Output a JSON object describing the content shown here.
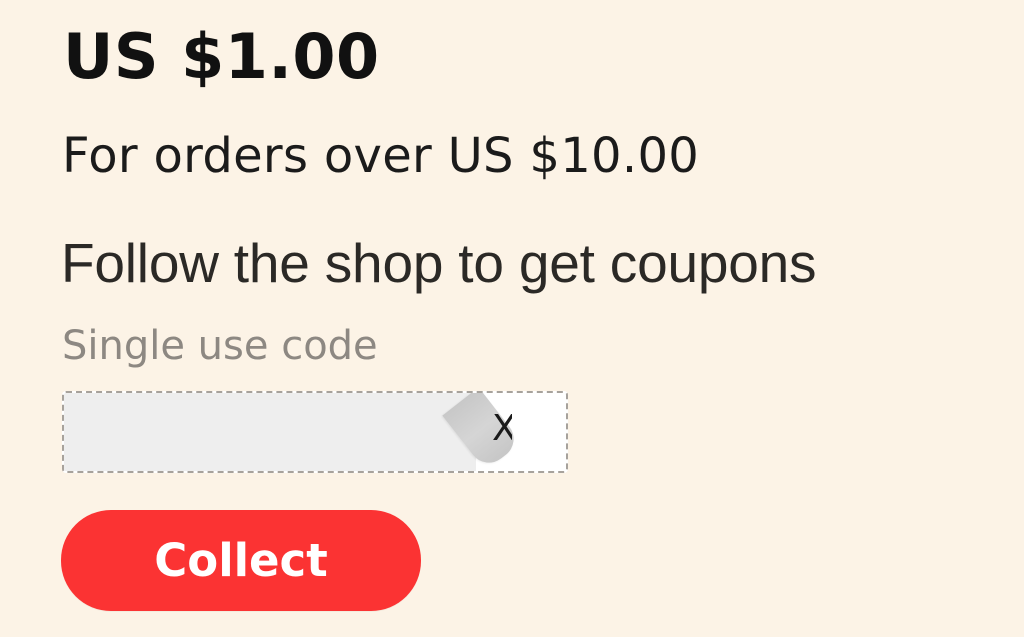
{
  "coupon": {
    "amount": "US $1.00",
    "condition": "For orders over US $10.00",
    "follow_note": "Follow the shop to get coupons",
    "code_label": "Single use code",
    "partially_visible_code": "X"
  },
  "actions": {
    "collect_label": "Collect"
  },
  "colors": {
    "background": "#fcf3e6",
    "collect_button": "#fb3333",
    "collect_text": "#ffffff"
  }
}
